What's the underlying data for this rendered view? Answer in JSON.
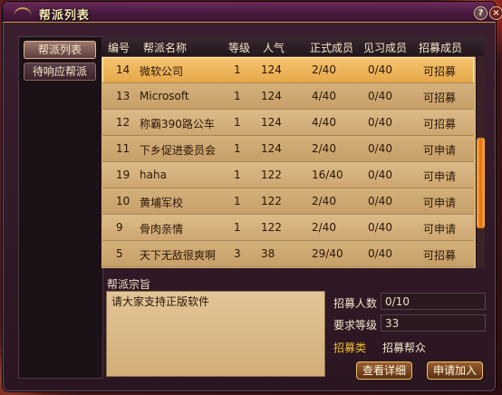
{
  "window": {
    "title": "帮派列表"
  },
  "title_buttons": {
    "help": "?",
    "close": "×"
  },
  "tabs": [
    {
      "label": "帮派列表",
      "active": true
    },
    {
      "label": "待响应帮派",
      "active": false
    }
  ],
  "table": {
    "headers": [
      "编号",
      "帮派名称",
      "等级",
      "人气",
      "正式成员",
      "见习成员",
      "招募成员"
    ],
    "rows": [
      {
        "id": "14",
        "name": "微软公司",
        "level": "1",
        "popularity": "124",
        "formal": "2/40",
        "trainee": "0/40",
        "status": "可招募",
        "selected": true
      },
      {
        "id": "13",
        "name": "Microsoft",
        "level": "1",
        "popularity": "124",
        "formal": "4/40",
        "trainee": "0/40",
        "status": "可招募"
      },
      {
        "id": "12",
        "name": "称霸390路公车",
        "level": "1",
        "popularity": "124",
        "formal": "4/40",
        "trainee": "0/40",
        "status": "可招募"
      },
      {
        "id": "11",
        "name": "下乡促进委员会",
        "level": "1",
        "popularity": "124",
        "formal": "2/40",
        "trainee": "0/40",
        "status": "可申请"
      },
      {
        "id": "19",
        "name": "haha",
        "level": "1",
        "popularity": "122",
        "formal": "16/40",
        "trainee": "0/40",
        "status": "可申请"
      },
      {
        "id": "10",
        "name": "黄埔军校",
        "level": "1",
        "popularity": "122",
        "formal": "2/40",
        "trainee": "0/40",
        "status": "可申请"
      },
      {
        "id": "9",
        "name": "骨肉亲情",
        "level": "1",
        "popularity": "122",
        "formal": "2/40",
        "trainee": "0/40",
        "status": "可申请"
      },
      {
        "id": "5",
        "name": "天下无敌很爽啊",
        "level": "3",
        "popularity": "38",
        "formal": "29/40",
        "trainee": "0/40",
        "status": "可招募"
      }
    ]
  },
  "detail": {
    "purpose_label": "帮派宗旨",
    "purpose_text": "请大家支持正版软件",
    "recruit_count_label": "招募人数",
    "recruit_count_value": "0/10",
    "required_level_label": "要求等级",
    "required_level_value": "33",
    "recruit_type_label": "招募类",
    "recruit_type_value": "招募帮众"
  },
  "actions": {
    "view_detail": "查看详细",
    "apply_join": "申请加入"
  },
  "colors": {
    "row_selected": "#f4c570",
    "row_normal": "#d4b07a",
    "accent_gold": "#f0c030"
  }
}
